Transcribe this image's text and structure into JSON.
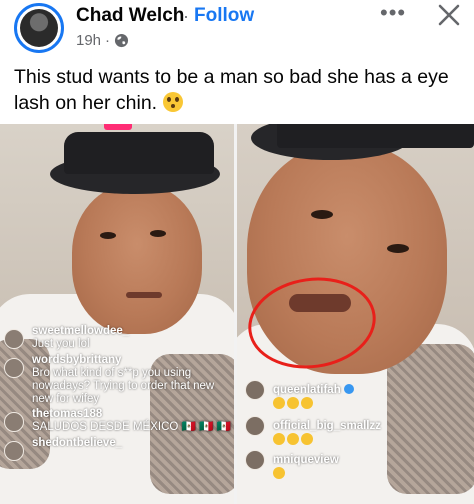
{
  "post": {
    "author": "Chad Welch",
    "separator": "·",
    "follow_label": "Follow",
    "time": "19h",
    "separator_small": "·",
    "more_label": "•••",
    "caption": "This stud wants to be a man so bad she has a eye lash on her chin.",
    "caption_emoji": "flushed-face-emoji"
  },
  "colors": {
    "accent": "#1877f2",
    "live": "#ff2d75",
    "annotation": "#e8201a"
  },
  "left_live": {
    "comments": [
      {
        "user": "sweetmellowdee_",
        "text": "Just you lol"
      },
      {
        "user": "wordsbybrittany",
        "text": "Bro what kind of s**p you using nowadays? Trying to order that new new for wifey"
      },
      {
        "user": "thetomas188",
        "text": "SALUDOS DESDE MÉXICO 🇲🇽 🇲🇽 🇲🇽"
      },
      {
        "user": "shedontbelieve_",
        "text": ""
      }
    ]
  },
  "right_live": {
    "comments": [
      {
        "user": "queenlatifah",
        "verified": true
      },
      {
        "user": "official_big_smallzz"
      },
      {
        "user": "mniqueview"
      }
    ]
  }
}
